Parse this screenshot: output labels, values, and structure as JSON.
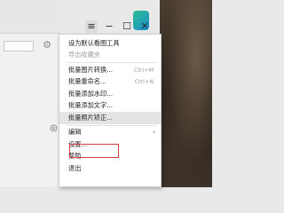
{
  "titlebar": {
    "menu_icon": "≡",
    "minimize_icon": "−",
    "maximize_icon": "☐",
    "close_icon": "✕"
  },
  "left_panel": {
    "settings_glyph": "⚙",
    "bookmark_glyph": "◎"
  },
  "menu": {
    "items": [
      {
        "label": "设为默认看图工具",
        "shortcut": "",
        "disabled": false
      },
      {
        "label": "导出收藏夹",
        "shortcut": "",
        "disabled": true
      },
      {
        "label": "批量图片转换...",
        "shortcut": "Ctrl+M",
        "disabled": false
      },
      {
        "label": "批量重命名...",
        "shortcut": "Ctrl+N",
        "disabled": false
      },
      {
        "label": "批量添加水印...",
        "shortcut": "",
        "disabled": false
      },
      {
        "label": "批量添加文字...",
        "shortcut": "",
        "disabled": false
      },
      {
        "label": "批量照片矫正...",
        "shortcut": "",
        "disabled": false
      },
      {
        "label": "编辑",
        "shortcut": "",
        "disabled": false,
        "submenu": "›"
      },
      {
        "label": "设置...",
        "shortcut": "",
        "disabled": false
      },
      {
        "label": "帮助",
        "shortcut": "",
        "disabled": false
      },
      {
        "label": "退出",
        "shortcut": "",
        "disabled": false
      }
    ]
  },
  "colors": {
    "highlight_border": "#d14141",
    "menu_background": "#ffffff"
  }
}
